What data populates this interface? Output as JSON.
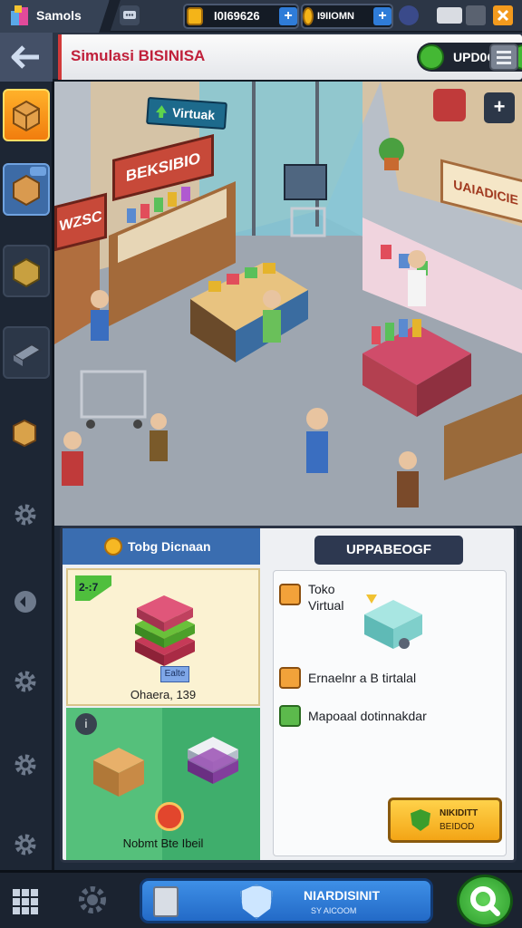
{
  "topbar": {
    "app_name": "Samols",
    "currency_value": "I0I69626",
    "gems_value": "I9IIOMN"
  },
  "header": {
    "title": "Simulasi BISINISA",
    "update_label": "UPD0O8"
  },
  "scene": {
    "sign_virtual": "Virtuak",
    "sign_left_store": "BEKSIBIO",
    "sign_left_wall": "WZSC",
    "sign_right_store": "UAIADICIE"
  },
  "panel": {
    "left_tab_title": "Tobg Dicnaan",
    "card_badge": "2-:7",
    "card_price_tag": "Ealte",
    "card_price": "Ohaera, 139",
    "card_bottom_label": "Nobmt Bte Ibeil",
    "right_title": "UPPABEOGF",
    "items": [
      {
        "label_line1": "Toko",
        "label_line2": "Virtual"
      },
      {
        "label": "Ernaelnr a B tirtalal"
      },
      {
        "label": "Mapoaal dotinnakdar"
      }
    ],
    "upgrade_button": {
      "line1": "NIKIDITT",
      "line2": "BEIDOD"
    }
  },
  "bottom_nav": {
    "main_line1": "NIARDISINIT",
    "main_line2": "SY AICOOM"
  },
  "colors": {
    "accent_orange": "#f39a1d",
    "panel_blue": "#3a6db0",
    "title_red": "#c0203a",
    "go_green": "#44b834"
  }
}
